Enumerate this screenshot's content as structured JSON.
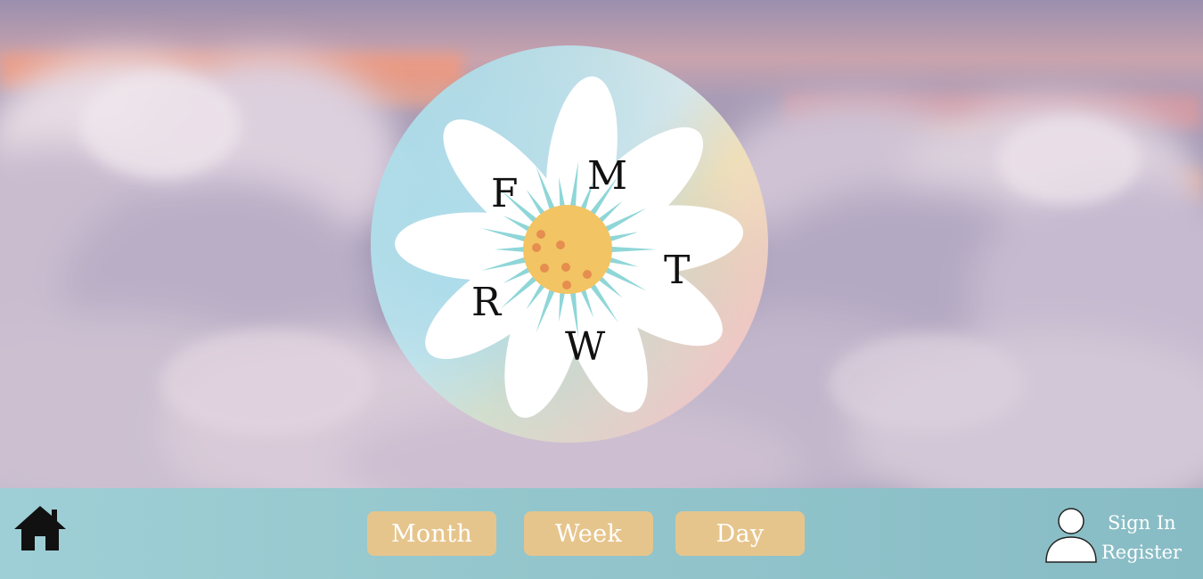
{
  "logo": {
    "letters": {
      "m": "M",
      "t": "T",
      "w": "W",
      "r": "R",
      "f": "F"
    },
    "colors": {
      "petal": "#ffffff",
      "center": "#f2c464",
      "center_dots": "#e58e4f",
      "rays": "#8fd6d8"
    }
  },
  "bottom_bar": {
    "home_icon": "home-icon",
    "views": {
      "month": "Month",
      "week": "Week",
      "day": "Day"
    },
    "account": {
      "icon": "user-icon",
      "sign_in": "Sign In",
      "register": "Register"
    },
    "colors": {
      "bar": "#93c6cc",
      "button": "#e6c58d"
    }
  }
}
